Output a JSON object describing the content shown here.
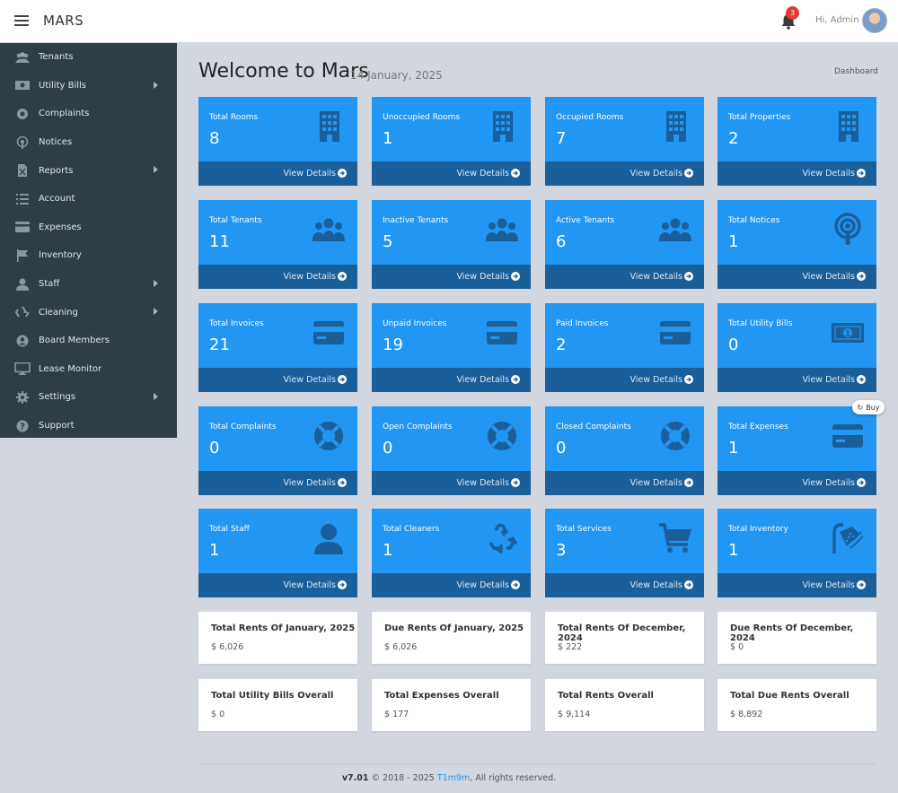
{
  "header": {
    "brand": "MARS",
    "notification_count": "3",
    "greeting": "Hi, Admin"
  },
  "sidebar": {
    "items": [
      {
        "label": "Tenants",
        "icon": "users-icon",
        "has_submenu": false
      },
      {
        "label": "Utility Bills",
        "icon": "money-bill-icon",
        "has_submenu": true
      },
      {
        "label": "Complaints",
        "icon": "life-ring-icon",
        "has_submenu": false
      },
      {
        "label": "Notices",
        "icon": "podcast-icon",
        "has_submenu": false
      },
      {
        "label": "Reports",
        "icon": "file-excel-icon",
        "has_submenu": true
      },
      {
        "label": "Account",
        "icon": "list-icon",
        "has_submenu": false
      },
      {
        "label": "Expenses",
        "icon": "credit-card-icon",
        "has_submenu": false
      },
      {
        "label": "Inventory",
        "icon": "flag-icon",
        "has_submenu": false
      },
      {
        "label": "Staff",
        "icon": "user-icon",
        "has_submenu": true
      },
      {
        "label": "Cleaning",
        "icon": "recycle-icon",
        "has_submenu": true
      },
      {
        "label": "Board Members",
        "icon": "user-circle-icon",
        "has_submenu": false
      },
      {
        "label": "Lease Monitor",
        "icon": "desktop-icon",
        "has_submenu": false
      },
      {
        "label": "Settings",
        "icon": "gear-icon",
        "has_submenu": true
      },
      {
        "label": "Support",
        "icon": "question-circle-icon",
        "has_submenu": false
      }
    ]
  },
  "main": {
    "title": "Welcome to Mars",
    "date": "14 January, 2025",
    "breadcrumb": "Dashboard",
    "view_details_label": "View Details",
    "tiles": [
      {
        "label": "Total Rooms",
        "value": "8",
        "icon": "building-icon"
      },
      {
        "label": "Unoccupied Rooms",
        "value": "1",
        "icon": "building-icon"
      },
      {
        "label": "Occupied Rooms",
        "value": "7",
        "icon": "building-icon"
      },
      {
        "label": "Total Properties",
        "value": "2",
        "icon": "building-icon"
      },
      {
        "label": "Total Tenants",
        "value": "11",
        "icon": "users-icon"
      },
      {
        "label": "Inactive Tenants",
        "value": "5",
        "icon": "users-icon"
      },
      {
        "label": "Active Tenants",
        "value": "6",
        "icon": "users-icon"
      },
      {
        "label": "Total Notices",
        "value": "1",
        "icon": "podcast-icon"
      },
      {
        "label": "Total Invoices",
        "value": "21",
        "icon": "credit-card-icon"
      },
      {
        "label": "Unpaid Invoices",
        "value": "19",
        "icon": "credit-card-icon"
      },
      {
        "label": "Paid Invoices",
        "value": "2",
        "icon": "credit-card-icon"
      },
      {
        "label": "Total Utility Bills",
        "value": "0",
        "icon": "money-bill-icon"
      },
      {
        "label": "Total Complaints",
        "value": "0",
        "icon": "life-ring-icon"
      },
      {
        "label": "Open Complaints",
        "value": "0",
        "icon": "life-ring-icon"
      },
      {
        "label": "Closed Complaints",
        "value": "0",
        "icon": "life-ring-icon"
      },
      {
        "label": "Total Expenses",
        "value": "1",
        "icon": "credit-card-icon"
      },
      {
        "label": "Total Staff",
        "value": "1",
        "icon": "user-icon"
      },
      {
        "label": "Total Cleaners",
        "value": "1",
        "icon": "recycle-icon"
      },
      {
        "label": "Total Services",
        "value": "3",
        "icon": "shopping-cart-icon"
      },
      {
        "label": "Total Inventory",
        "value": "1",
        "icon": "shower-icon"
      }
    ],
    "summary_cards": [
      {
        "label": "Total Rents Of January, 2025",
        "value": "$ 6,026"
      },
      {
        "label": "Due Rents Of January, 2025",
        "value": "$ 6,026"
      },
      {
        "label": "Total Rents Of December, 2024",
        "value": "$ 222"
      },
      {
        "label": "Due Rents Of December, 2024",
        "value": "$ 0"
      },
      {
        "label": "Total Utility Bills Overall",
        "value": "$ 0"
      },
      {
        "label": "Total Expenses Overall",
        "value": "$ 177"
      },
      {
        "label": "Total Rents Overall",
        "value": "$ 9,114"
      },
      {
        "label": "Total Due Rents Overall",
        "value": "$ 8,892"
      }
    ],
    "buy_label": "Buy"
  },
  "footer": {
    "version": "v7.01",
    "copyright": "© 2018 - 2025",
    "author": "T1m9m",
    "rights": ", All rights reserved."
  },
  "colors": {
    "tile_bg": "#2196f3",
    "tile_footer": "#1a5e9a",
    "sidebar_bg": "#2f3e46",
    "page_bg": "#d2d6de",
    "badge": "#e53935"
  }
}
